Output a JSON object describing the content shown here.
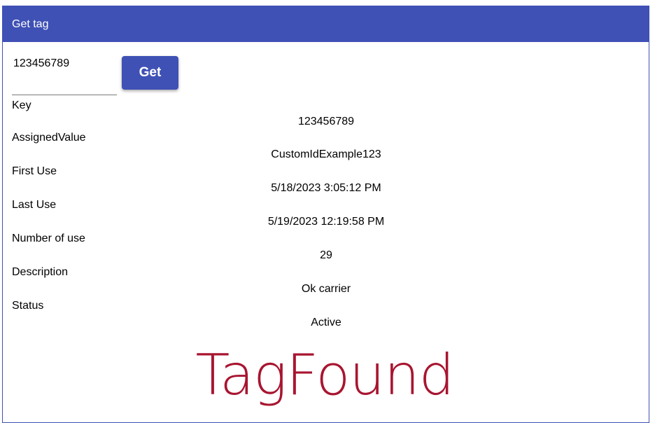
{
  "window": {
    "title": "Get tag"
  },
  "form": {
    "key_input_value": "123456789",
    "get_button_label": "Get"
  },
  "fields": [
    {
      "label": "Key",
      "value": "123456789"
    },
    {
      "label": "AssignedValue",
      "value": "CustomIdExample123"
    },
    {
      "label": "First Use",
      "value": "5/18/2023 3:05:12 PM"
    },
    {
      "label": "Last Use",
      "value": "5/19/2023 12:19:58 PM"
    },
    {
      "label": "Number of use",
      "value": "29"
    },
    {
      "label": "Description",
      "value": "Ok carrier"
    },
    {
      "label": "Status",
      "value": "Active"
    }
  ],
  "result": {
    "text": "TagFound",
    "color": "#a81530"
  },
  "colors": {
    "accent": "#3f51b5"
  }
}
